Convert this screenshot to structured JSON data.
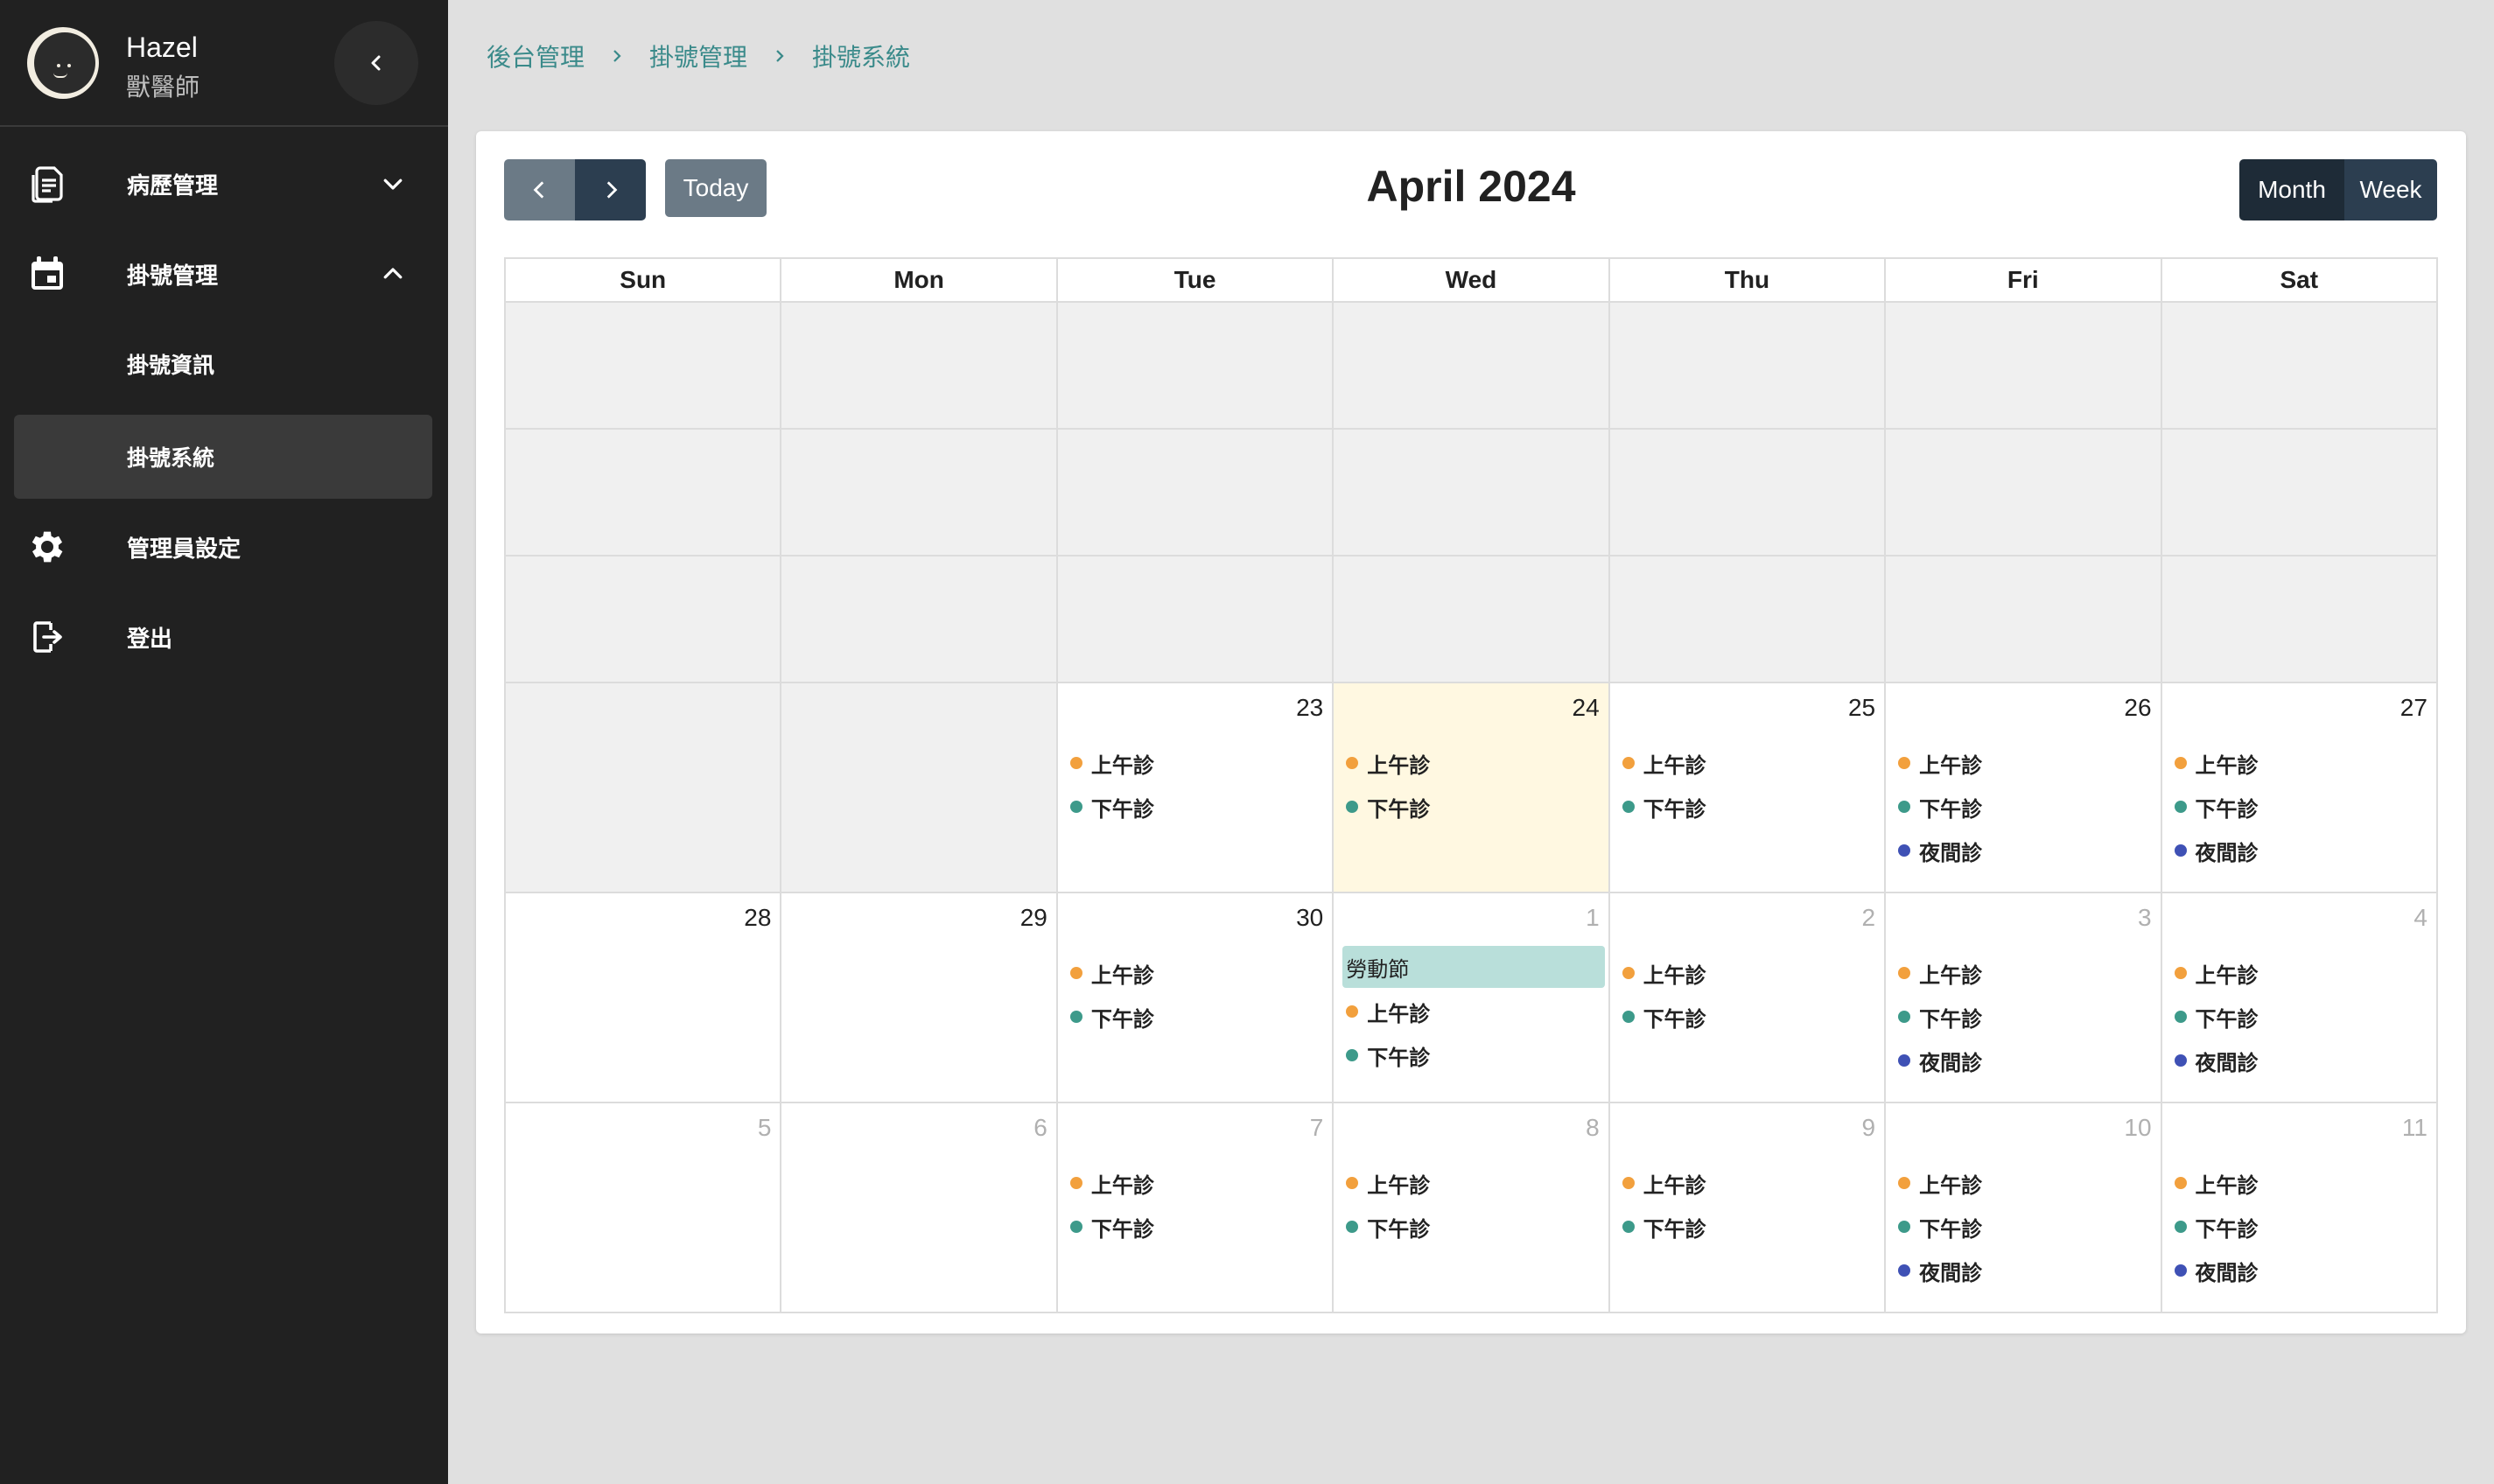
{
  "user": {
    "name": "Hazel",
    "role": "獸醫師"
  },
  "nav": {
    "medical_records": "病歷管理",
    "registration": "掛號管理",
    "registration_info": "掛號資訊",
    "registration_system": "掛號系統",
    "admin_settings": "管理員設定",
    "logout": "登出"
  },
  "breadcrumb": [
    "後台管理",
    "掛號管理",
    "掛號系統"
  ],
  "calendar": {
    "title": "April 2024",
    "today_label": "Today",
    "view_month": "Month",
    "view_week": "Week",
    "weekdays": [
      "Sun",
      "Mon",
      "Tue",
      "Wed",
      "Thu",
      "Fri",
      "Sat"
    ],
    "weeks": [
      {
        "height": "short",
        "days": [
          {
            "empty": true
          },
          {
            "empty": true
          },
          {
            "empty": true
          },
          {
            "empty": true
          },
          {
            "empty": true
          },
          {
            "empty": true
          },
          {
            "empty": true
          }
        ]
      },
      {
        "height": "short",
        "days": [
          {
            "empty": true
          },
          {
            "empty": true
          },
          {
            "empty": true
          },
          {
            "empty": true
          },
          {
            "empty": true
          },
          {
            "empty": true
          },
          {
            "empty": true
          }
        ]
      },
      {
        "height": "short",
        "days": [
          {
            "empty": true
          },
          {
            "empty": true
          },
          {
            "empty": true
          },
          {
            "empty": true
          },
          {
            "empty": true
          },
          {
            "empty": true
          },
          {
            "empty": true
          }
        ]
      },
      {
        "height": "tall",
        "days": [
          {
            "empty": true
          },
          {
            "empty": true
          },
          {
            "num": "23",
            "events": [
              "am",
              "pm"
            ]
          },
          {
            "num": "24",
            "today": true,
            "events": [
              "am",
              "pm"
            ]
          },
          {
            "num": "25",
            "events": [
              "am",
              "pm"
            ]
          },
          {
            "num": "26",
            "events": [
              "am",
              "pm",
              "night"
            ]
          },
          {
            "num": "27",
            "events": [
              "am",
              "pm",
              "night"
            ]
          }
        ]
      },
      {
        "height": "tall",
        "days": [
          {
            "num": "28",
            "events": []
          },
          {
            "num": "29",
            "events": []
          },
          {
            "num": "30",
            "events": [
              "am",
              "pm"
            ]
          },
          {
            "num": "1",
            "other": true,
            "holiday": "勞動節",
            "events": [
              "am",
              "pm"
            ]
          },
          {
            "num": "2",
            "other": true,
            "events": [
              "am",
              "pm"
            ]
          },
          {
            "num": "3",
            "other": true,
            "events": [
              "am",
              "pm",
              "night"
            ]
          },
          {
            "num": "4",
            "other": true,
            "events": [
              "am",
              "pm",
              "night"
            ]
          }
        ]
      },
      {
        "height": "tall",
        "days": [
          {
            "num": "5",
            "other": true,
            "events": []
          },
          {
            "num": "6",
            "other": true,
            "events": []
          },
          {
            "num": "7",
            "other": true,
            "events": [
              "am",
              "pm"
            ]
          },
          {
            "num": "8",
            "other": true,
            "events": [
              "am",
              "pm"
            ]
          },
          {
            "num": "9",
            "other": true,
            "events": [
              "am",
              "pm"
            ]
          },
          {
            "num": "10",
            "other": true,
            "events": [
              "am",
              "pm",
              "night"
            ]
          },
          {
            "num": "11",
            "other": true,
            "events": [
              "am",
              "pm",
              "night"
            ]
          }
        ]
      }
    ],
    "event_types": {
      "am": {
        "label": "上午診",
        "color": "#f2a03d"
      },
      "pm": {
        "label": "下午診",
        "color": "#3d9a8a"
      },
      "night": {
        "label": "夜間診",
        "color": "#3f51b5"
      }
    }
  },
  "colors": {
    "sidebar_bg": "#212121",
    "accent_teal": "#3a8a8a",
    "today_highlight": "#fff8e1",
    "holiday_bg": "#b9dfda"
  }
}
